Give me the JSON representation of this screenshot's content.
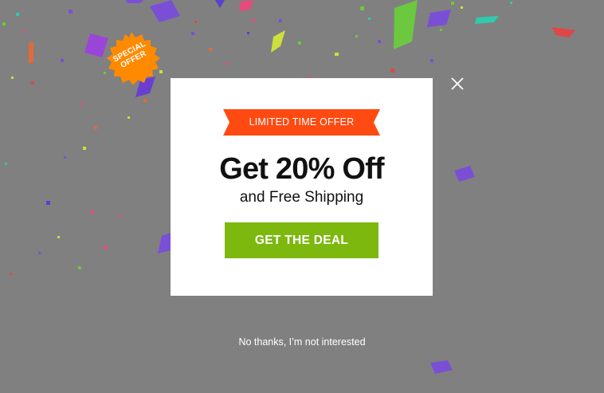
{
  "badge": {
    "line1": "SPECIAL",
    "line2": "OFFER",
    "color": "#ff8a00"
  },
  "modal": {
    "ribbon_label": "LIMITED TIME OFFER",
    "ribbon_color": "#ff4a12",
    "headline": "Get 20% Off",
    "subhead": "and Free Shipping",
    "cta_label": "GET THE DEAL",
    "cta_color": "#7db80f"
  },
  "close_icon": "close-icon",
  "decline_label": "No thanks, I’m not interested",
  "overlay_color": "#808080"
}
